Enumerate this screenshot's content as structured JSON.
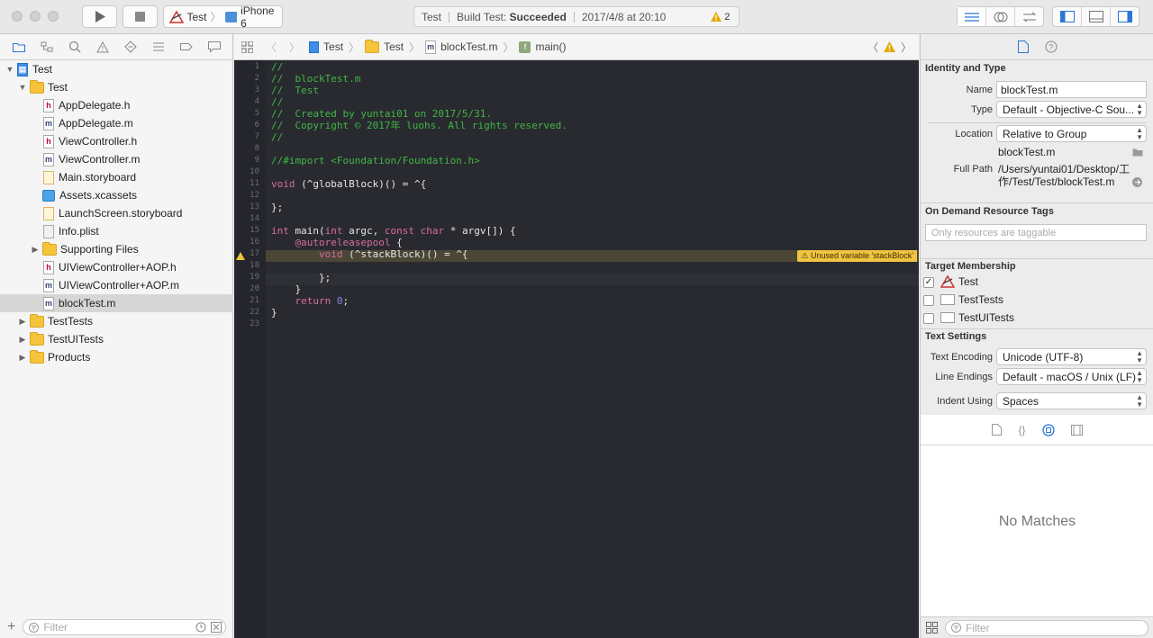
{
  "toolbar": {
    "scheme": "Test",
    "device": "iPhone 6",
    "activity_project": "Test",
    "activity_status_prefix": "Build Test: ",
    "activity_status": "Succeeded",
    "activity_time": "2017/4/8 at 20:10",
    "warning_count": "2"
  },
  "navigator": {
    "items": [
      {
        "label": "Test"
      },
      {
        "label": "Test"
      },
      {
        "label": "AppDelegate.h"
      },
      {
        "label": "AppDelegate.m"
      },
      {
        "label": "ViewController.h"
      },
      {
        "label": "ViewController.m"
      },
      {
        "label": "Main.storyboard"
      },
      {
        "label": "Assets.xcassets"
      },
      {
        "label": "LaunchScreen.storyboard"
      },
      {
        "label": "Info.plist"
      },
      {
        "label": "Supporting Files"
      },
      {
        "label": "UIViewController+AOP.h"
      },
      {
        "label": "UIViewController+AOP.m"
      },
      {
        "label": "blockTest.m"
      },
      {
        "label": "TestTests"
      },
      {
        "label": "TestUITests"
      },
      {
        "label": "Products"
      }
    ],
    "filter_placeholder": "Filter"
  },
  "jumpbar": {
    "project": "Test",
    "group": "Test",
    "file": "blockTest.m",
    "symbol": "main()"
  },
  "editor": {
    "lines": [
      "//",
      "//  blockTest.m",
      "//  Test",
      "//",
      "//  Created by yuntai01 on 2017/5/31.",
      "//  Copyright © 2017年 luohs. All rights reserved.",
      "//",
      "",
      "//#import <Foundation/Foundation.h>",
      "",
      "void (^globalBlock)() = ^{",
      "",
      "};",
      "",
      "int main(int argc, const char * argv[]) {",
      "    @autoreleasepool {",
      "        void (^stackBlock)() = ^{",
      "",
      "        };",
      "    }",
      "    return 0;",
      "}",
      ""
    ],
    "warning_text": "Unused variable 'stackBlock'"
  },
  "inspector": {
    "identity_title": "Identity and Type",
    "name_label": "Name",
    "name_value": "blockTest.m",
    "type_label": "Type",
    "type_value": "Default - Objective-C Sou...",
    "location_label": "Location",
    "location_value": "Relative to Group",
    "location_file": "blockTest.m",
    "fullpath_label": "Full Path",
    "fullpath_value_1": "/Users/yuntai01/Desktop/工",
    "fullpath_value_2": "作/Test/Test/blockTest.m",
    "odr_title": "On Demand Resource Tags",
    "odr_placeholder": "Only resources are taggable",
    "membership_title": "Target Membership",
    "targets": [
      {
        "label": "Test",
        "checked": true
      },
      {
        "label": "TestTests",
        "checked": false
      },
      {
        "label": "TestUITests",
        "checked": false
      }
    ],
    "text_settings_title": "Text Settings",
    "encoding_label": "Text Encoding",
    "encoding_value": "Unicode (UTF-8)",
    "endings_label": "Line Endings",
    "endings_value": "Default - macOS / Unix (LF)",
    "indent_label": "Indent Using",
    "indent_value": "Spaces"
  },
  "library": {
    "empty_text": "No Matches",
    "filter_placeholder": "Filter"
  },
  "colors": {
    "editor_bg": "#292a30",
    "comment": "#41b645",
    "keyword": "#d66ca0",
    "number": "#8e80e8",
    "warning": "#f0c341"
  }
}
